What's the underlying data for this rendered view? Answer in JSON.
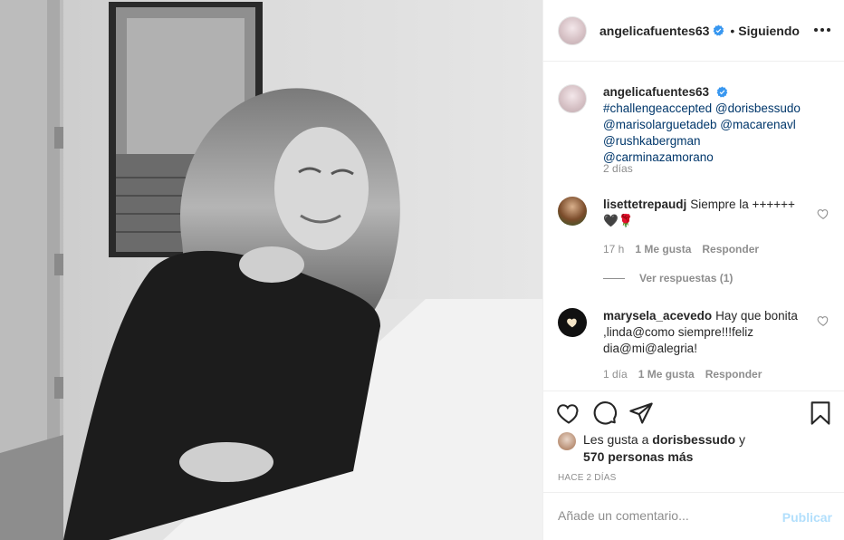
{
  "post": {
    "author": "angelicafuentes63",
    "follow_separator": "•",
    "follow_status": "Siguiendo",
    "caption": {
      "hashtag": "#challengeaccepted",
      "mentions": [
        "@dorisbessudo",
        "@marisolarguetadeb",
        "@macarenavl",
        "@rushkabergman",
        "@carminazamorano"
      ],
      "time": "2 días"
    }
  },
  "comments": [
    {
      "username": "lisettetrepaudj",
      "text": "Siempre la ++++++ 🖤🌹",
      "time": "17 h",
      "likes": "1 Me gusta",
      "reply_label": "Responder",
      "view_replies": "Ver respuestas (1)"
    },
    {
      "username": "marysela_acevedo",
      "text": "Hay que bonita ,linda@como siempre!!!feliz dia@mi@alegria!",
      "time": "1 día",
      "likes": "1 Me gusta",
      "reply_label": "Responder"
    }
  ],
  "likes": {
    "prefix": "Les gusta a",
    "user": "dorisbessudo",
    "conj": "y",
    "others": "570 personas más"
  },
  "timestamp": "Hace 2 días",
  "add_comment": {
    "placeholder": "Añade un comentario...",
    "publish_label": "Publicar"
  },
  "colors": {
    "verified": "#3897f0",
    "publish_disabled": "#b2dffc",
    "secondary_text": "#8e8e8e",
    "mention": "#00376b"
  },
  "icons": [
    "more-options-icon",
    "verified-badge-icon",
    "heart-icon",
    "comment-icon",
    "share-icon",
    "bookmark-icon",
    "comment-heart-icon"
  ]
}
